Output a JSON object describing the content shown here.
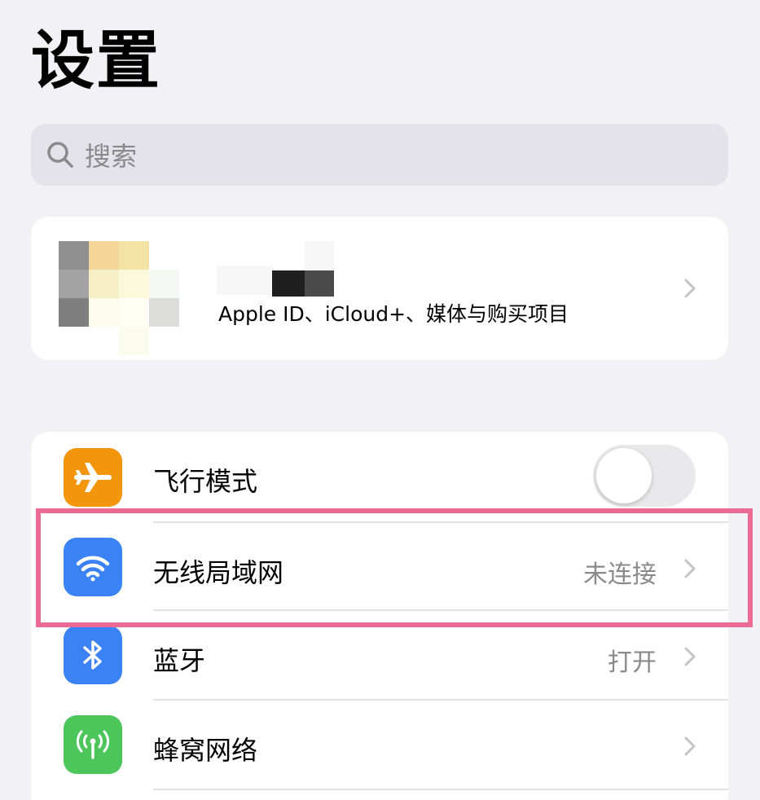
{
  "header": {
    "title": "设置"
  },
  "search": {
    "placeholder": "搜索",
    "icon": "magnifier"
  },
  "profile": {
    "subtitle": "Apple ID、iCloud+、媒体与购买项目"
  },
  "settings": {
    "items": [
      {
        "label": "飞行模式",
        "icon": "airplane-icon",
        "icon_color": "#f3960b",
        "control": "toggle",
        "toggle_on": false
      },
      {
        "label": "无线局域网",
        "icon": "wifi-icon",
        "icon_color": "#3b82f6",
        "value": "未连接",
        "highlighted": true
      },
      {
        "label": "蓝牙",
        "icon": "bluetooth-icon",
        "icon_color": "#3b82f6",
        "value": "打开"
      },
      {
        "label": "蜂窝网络",
        "icon": "cellular-antenna-icon",
        "icon_color": "#4cc65a",
        "value": ""
      }
    ]
  },
  "colors": {
    "background": "#f2f1f6",
    "highlight_border": "#ea6c94"
  }
}
